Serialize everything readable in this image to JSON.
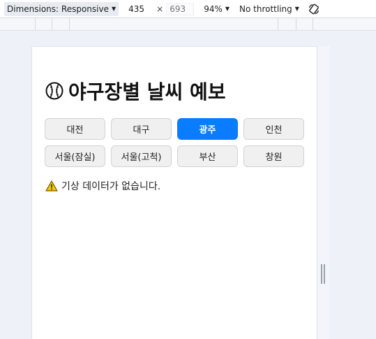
{
  "devtools": {
    "dimensions_label": "Dimensions: Responsive",
    "width_value": "435",
    "height_placeholder": "693",
    "times_sign": "×",
    "zoom": "94%",
    "throttling": "No throttling"
  },
  "page": {
    "title": "야구장별 날씨 예보",
    "title_icon": "baseball-icon",
    "stadiums": [
      {
        "label": "대전",
        "active": false
      },
      {
        "label": "대구",
        "active": false
      },
      {
        "label": "광주",
        "active": true
      },
      {
        "label": "인천",
        "active": false
      },
      {
        "label": "서울(잠실)",
        "active": false
      },
      {
        "label": "서울(고척)",
        "active": false
      },
      {
        "label": "부산",
        "active": false
      },
      {
        "label": "창원",
        "active": false
      }
    ],
    "notice_icon": "warning-icon",
    "notice": "기상 데이터가 없습니다."
  },
  "colors": {
    "accent": "#0a7cff",
    "button_bg": "#f0f0f0",
    "warning": "#f5c400"
  }
}
